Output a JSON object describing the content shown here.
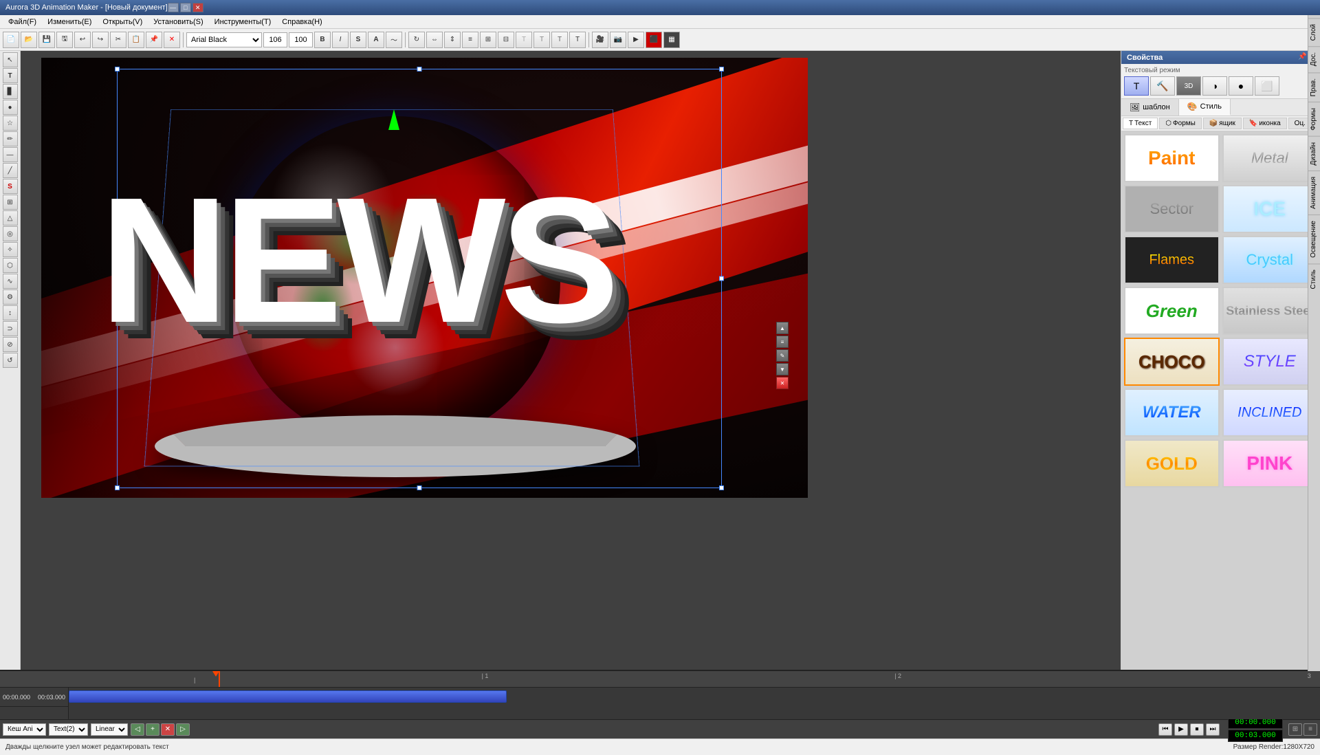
{
  "app": {
    "title": "Aurora 3D Animation Maker - [Новый документ]",
    "min_label": "—",
    "max_label": "□",
    "close_label": "✕"
  },
  "menu": {
    "items": [
      "Файл(F)",
      "Изменить(E)",
      "Открыть(V)",
      "Установить(S)",
      "Инструменты(T)",
      "Справка(H)"
    ]
  },
  "toolbar": {
    "font_name": "Arial Black",
    "font_size": "106",
    "font_scale": "100"
  },
  "left_toolbar": {
    "tools": [
      "↖",
      "T",
      "▊",
      "●",
      "☆",
      "✏",
      "—",
      "╱",
      "S",
      "⊞",
      "△",
      "◎",
      "✧",
      "⬡",
      "∿",
      "⚙"
    ]
  },
  "properties": {
    "title": "Свойства",
    "close_label": "✕",
    "text_mode_label": "Текстовый режим",
    "mode_buttons": [
      "T",
      "🔨",
      "⬡",
      "◑",
      "●",
      "◫"
    ],
    "tabs": {
      "tab1_label": "шаблон",
      "tab2_label": "Стиль"
    },
    "sub_tabs": [
      "Текст",
      "Формы",
      "ящик",
      "иконка",
      "Oц."
    ],
    "styles": [
      {
        "id": "paint",
        "label": "Paint",
        "class": "style-paint"
      },
      {
        "id": "metal",
        "label": "Metal",
        "class": "style-metal"
      },
      {
        "id": "sector",
        "label": "Sector",
        "class": "style-sector"
      },
      {
        "id": "ice",
        "label": "ICE",
        "class": "style-ice"
      },
      {
        "id": "flames",
        "label": "Flames",
        "class": "style-flames"
      },
      {
        "id": "crystal",
        "label": "Crystal",
        "class": "style-crystal"
      },
      {
        "id": "green",
        "label": "Green",
        "class": "style-green"
      },
      {
        "id": "stainless",
        "label": "Stainless Steel",
        "class": "style-stainless"
      },
      {
        "id": "choco",
        "label": "CHOCO",
        "class": "style-choco"
      },
      {
        "id": "style",
        "label": "STYLE",
        "class": "style-style"
      },
      {
        "id": "water",
        "label": "WATER",
        "class": "style-water"
      },
      {
        "id": "inclined",
        "label": "INCLINED",
        "class": "style-inclined"
      },
      {
        "id": "gold",
        "label": "GOLD",
        "class": "style-gold"
      },
      {
        "id": "pink",
        "label": "PINK",
        "class": "style-pink"
      }
    ]
  },
  "right_tabs": [
    "Слой",
    "Дос.",
    "Прав.",
    "Формы",
    "Дизайн",
    "Анимация",
    "Освещение",
    "Стиль"
  ],
  "timeline": {
    "ruler_marks": [
      "1",
      "2",
      "3"
    ],
    "timecodes": [
      "00:00.000",
      "00:03.000"
    ],
    "track_labels": [
      "Кеш Ani",
      "Text(2)"
    ],
    "playhead_position": "38%",
    "anim_select1": "Кеш Ani",
    "anim_select2": "Text(2)",
    "anim_type": "Linear"
  },
  "statusbar": {
    "hint": "Дважды щелкните узел может редактировать текст",
    "render_size": "Размер Render:1280X720"
  },
  "canvas": {
    "news_text": "NEWS"
  }
}
